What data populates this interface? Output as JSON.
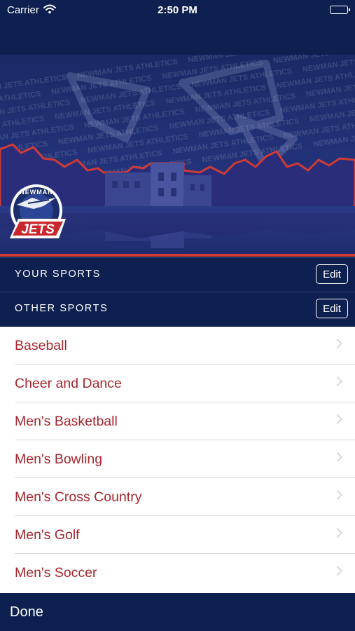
{
  "status_bar": {
    "carrier": "Carrier",
    "time": "2:50 PM"
  },
  "hero": {
    "logo_top_text": "NEWMAN",
    "logo_main_text": "JETS",
    "watermark_text": "NEWMAN JETS ATHLETICS"
  },
  "your_sports": {
    "title": "YOUR SPORTS",
    "edit_label": "Edit"
  },
  "other_sports": {
    "title": "OTHER SPORTS",
    "edit_label": "Edit"
  },
  "sports": [
    {
      "label": "Baseball"
    },
    {
      "label": "Cheer and Dance"
    },
    {
      "label": "Men's Basketball"
    },
    {
      "label": "Men's Bowling"
    },
    {
      "label": "Men's Cross Country"
    },
    {
      "label": "Men's Golf"
    },
    {
      "label": "Men's Soccer"
    }
  ],
  "bottom_bar": {
    "done_label": "Done"
  },
  "colors": {
    "navy": "#0e2050",
    "accent_red": "#a8262e",
    "list_bg": "#ffffff"
  }
}
